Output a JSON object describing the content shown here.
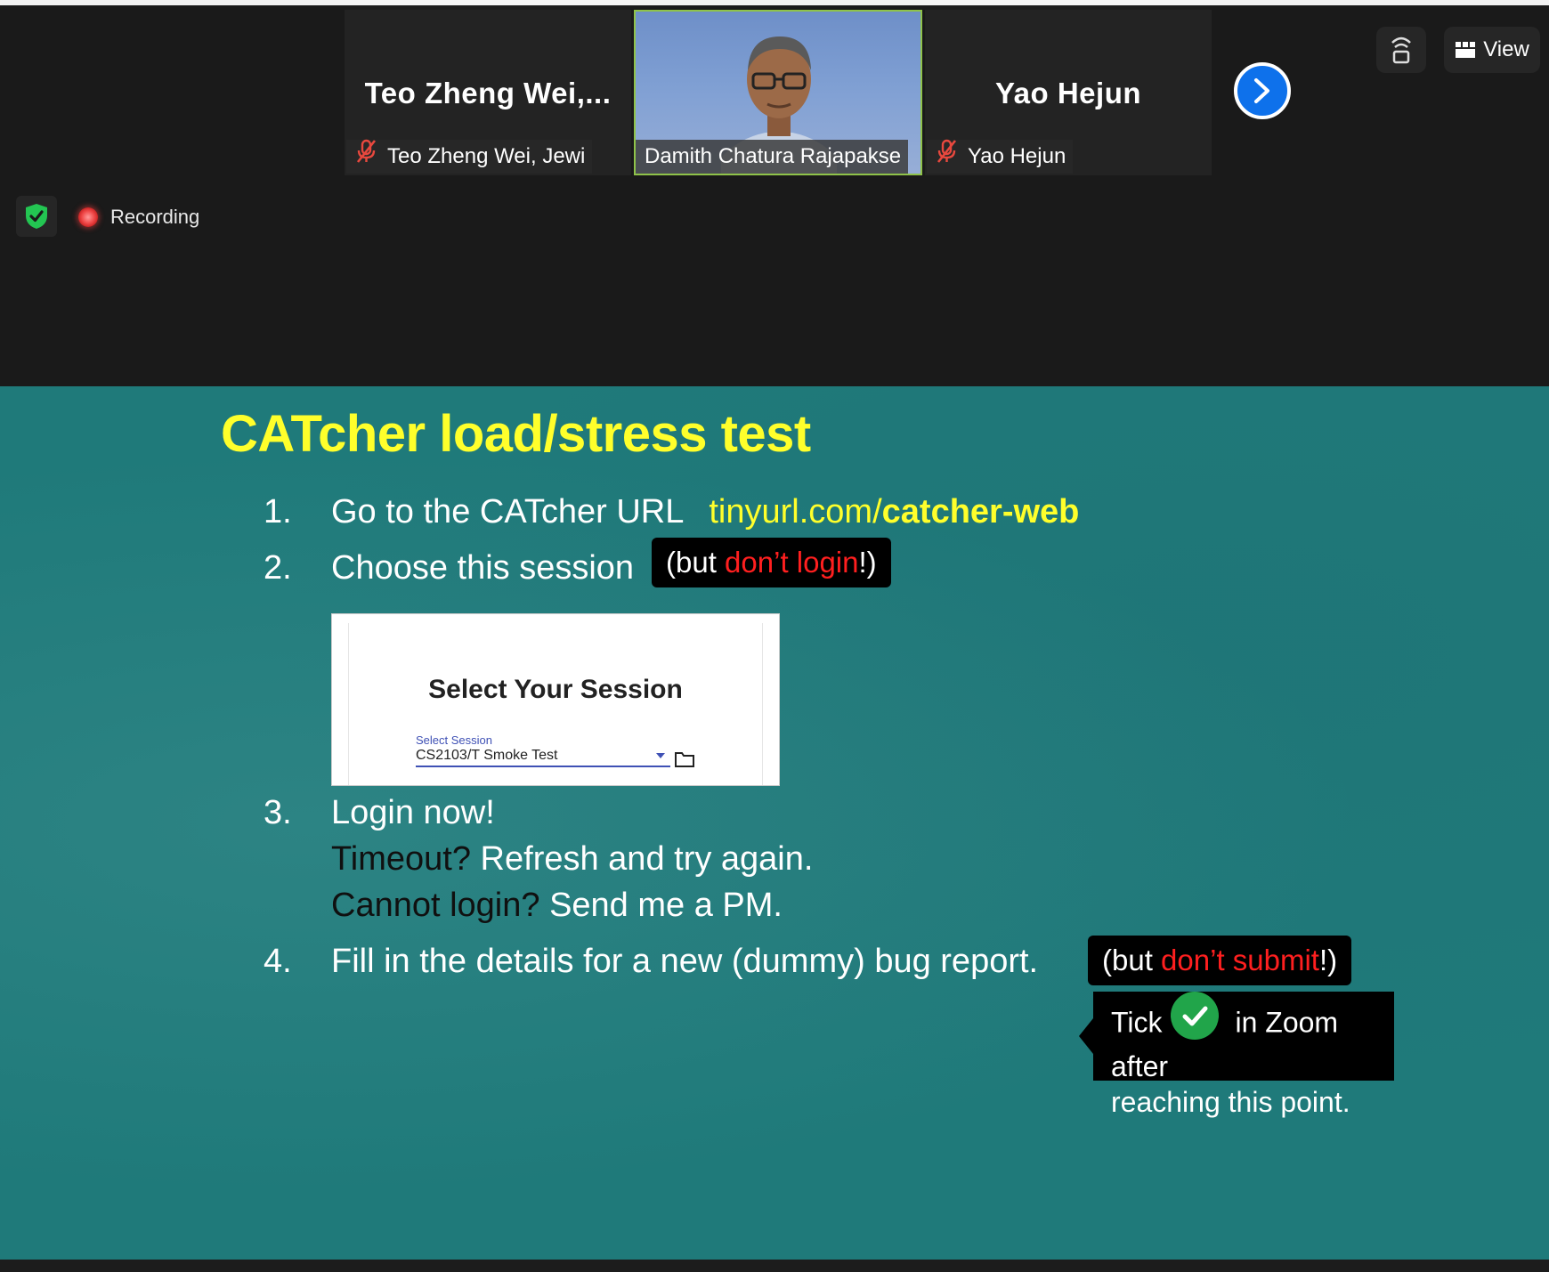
{
  "participants": [
    {
      "big_name": "Teo  Zheng  Wei,...",
      "tag": "Teo Zheng Wei, Jewi",
      "muted": true
    },
    {
      "big_name": "",
      "tag": "Damith Chatura Rajapakse",
      "muted": false
    },
    {
      "big_name": "Yao Hejun",
      "tag": "Yao Hejun",
      "muted": true
    }
  ],
  "toolbar": {
    "view_label": "View"
  },
  "status": {
    "recording_label": "Recording"
  },
  "slide": {
    "title": "CATcher load/stress test",
    "steps": [
      {
        "num": "1.",
        "text": "Go to the CATcher URL",
        "url_prefix": "tinyurl.com/",
        "url_bold": "catcher-web"
      },
      {
        "num": "2.",
        "text": "Choose this session"
      },
      {
        "num": "3.",
        "text": "Login now!"
      },
      {
        "num": "4.",
        "text": "Fill in the details for a new (dummy) bug report."
      }
    ],
    "step3_lines": [
      {
        "dark": "Timeout?",
        "rest": " Refresh and try again."
      },
      {
        "dark": "Cannot login?",
        "rest": " Send me a PM."
      }
    ],
    "callout_login": {
      "open": "(but ",
      "red": "don’t login",
      "close": "!)"
    },
    "callout_submit": {
      "open": "(but ",
      "red": "don’t submit",
      "close": "!)"
    },
    "tick_note": {
      "before": "Tick",
      "after": "in Zoom after",
      "line2": "reaching this point."
    },
    "session_card": {
      "title": "Select Your Session",
      "field_label": "Select Session",
      "field_value": "CS2103/T Smoke Test"
    }
  },
  "colors": {
    "slide_bg": "#1f7a7a",
    "title_yellow": "#ffff2b",
    "callout_red": "#ff1f1f",
    "zoom_blue": "#0e71eb"
  }
}
